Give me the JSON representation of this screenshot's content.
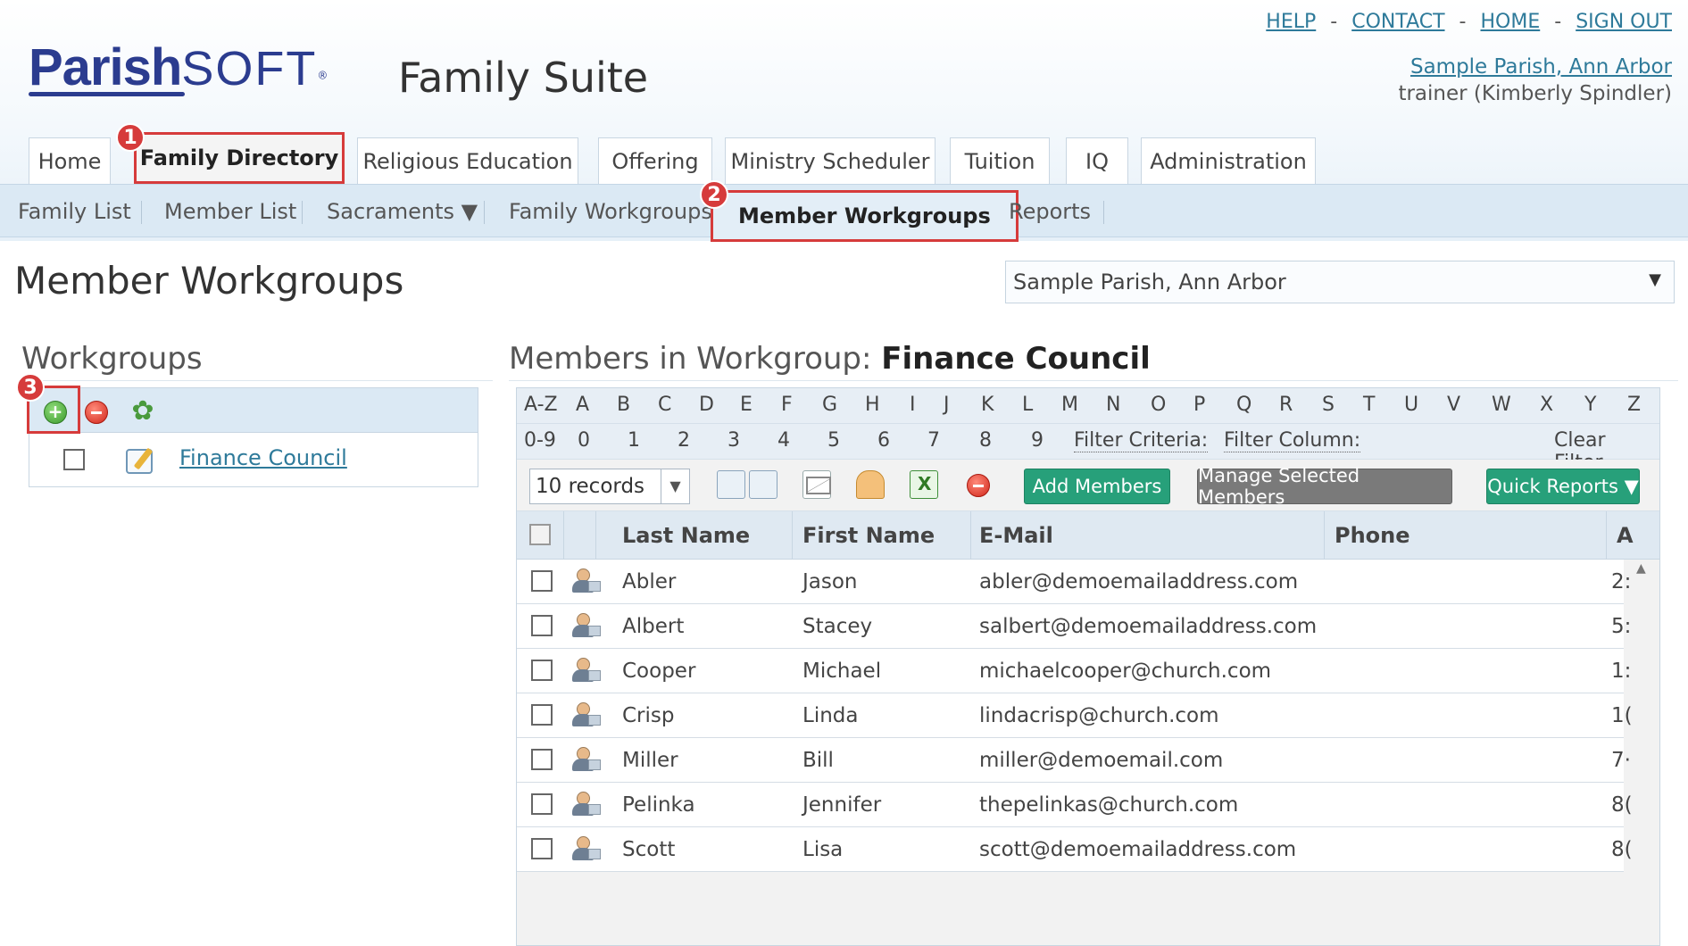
{
  "header": {
    "logo": "ParishSOFT",
    "app_title": "Family Suite",
    "toplinks": [
      "HELP",
      "CONTACT",
      "HOME",
      "SIGN OUT"
    ],
    "separator": "-",
    "parish_link": "Sample Parish, Ann Arbor",
    "user": "trainer (Kimberly Spindler)"
  },
  "tabs": [
    {
      "label": "Home"
    },
    {
      "label": "Family Directory",
      "active": true
    },
    {
      "label": "Religious Education"
    },
    {
      "label": "Offering"
    },
    {
      "label": "Ministry Scheduler"
    },
    {
      "label": "Tuition"
    },
    {
      "label": "IQ"
    },
    {
      "label": "Administration"
    }
  ],
  "subnav": [
    {
      "label": "Family List"
    },
    {
      "label": "Member List"
    },
    {
      "label": "Sacraments ▼"
    },
    {
      "label": "Family Workgroups"
    },
    {
      "label": "Member Workgroups",
      "active": true
    },
    {
      "label": "Reports"
    }
  ],
  "markers": [
    "1",
    "2",
    "3"
  ],
  "page": {
    "title": "Member Workgroups",
    "parish_select": "Sample Parish, Ann Arbor",
    "parish_select_arrow": "▼"
  },
  "workgroups": {
    "title": "Workgroups",
    "items": [
      {
        "label": "Finance Council"
      }
    ]
  },
  "members": {
    "title_prefix": "Members in Workgroup:",
    "workgroup_name": "Finance Council",
    "alpha": [
      "A-Z",
      "A",
      "B",
      "C",
      "D",
      "E",
      "F",
      "G",
      "H",
      "I",
      "J",
      "K",
      "L",
      "M",
      "N",
      "O",
      "P",
      "Q",
      "R",
      "S",
      "T",
      "U",
      "V",
      "W",
      "X",
      "Y",
      "Z"
    ],
    "digits": [
      "0-9",
      "0",
      "1",
      "2",
      "3",
      "4",
      "5",
      "6",
      "7",
      "8",
      "9"
    ],
    "filter_criteria": "Filter Criteria:",
    "filter_column": "Filter Column:",
    "clear_filter": "Clear Filter",
    "records_select": "10 records",
    "records_arrow": "▼",
    "add_members": "Add Members",
    "manage_selected": "Manage Selected Members",
    "quick_reports": "Quick Reports ▼",
    "columns": [
      "Last Name",
      "First Name",
      "E-Mail",
      "Phone",
      "A"
    ],
    "rows": [
      {
        "last": "Abler",
        "first": "Jason",
        "email": "abler@demoemailaddress.com",
        "a": "2:"
      },
      {
        "last": "Albert",
        "first": "Stacey",
        "email": "salbert@demoemailaddress.com",
        "a": "5:"
      },
      {
        "last": "Cooper",
        "first": "Michael",
        "email": "michaelcooper@church.com",
        "a": "1:"
      },
      {
        "last": "Crisp",
        "first": "Linda",
        "email": "lindacrisp@church.com",
        "a": "1("
      },
      {
        "last": "Miller",
        "first": "Bill",
        "email": "miller@demoemail.com",
        "a": "7·"
      },
      {
        "last": "Pelinka",
        "first": "Jennifer",
        "email": "thepelinkas@church.com",
        "a": "8("
      },
      {
        "last": "Scott",
        "first": "Lisa",
        "email": "scott@demoemailaddress.com",
        "a": "8("
      }
    ]
  },
  "colors": {
    "brand": "#2b3c8f",
    "link": "#2e7a9a",
    "highlight": "#d63b3b",
    "green_button": "#27a07a",
    "gray_button": "#7a7a7a"
  }
}
